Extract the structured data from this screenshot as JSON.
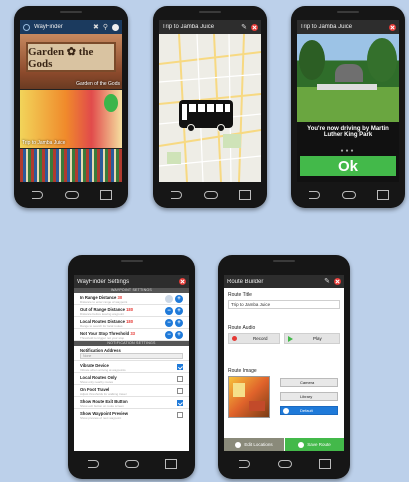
{
  "phone1": {
    "title": "WayFinder",
    "tiles": [
      {
        "image_text": "Garden ✿ the Gods",
        "caption": "Garden of the Gods"
      },
      {
        "caption": "Trip to Jamba Juice"
      },
      {
        "caption": ""
      }
    ]
  },
  "phone2": {
    "title": "Trip to Jamba Juice"
  },
  "phone3": {
    "title": "Trip to Jamba Juice",
    "driving_text": "You're now driving by Martin Luther King Park",
    "ok_label": "Ok"
  },
  "settings": {
    "title": "WayFinder Settings",
    "section1": "WAYPOINT SETTINGS",
    "rows": [
      {
        "label": "In Range Distance",
        "value": "30",
        "sub": "Distance to enter range of waypoint"
      },
      {
        "label": "Out of Range Distance",
        "value": "180",
        "sub": "Distance before leaving waypoint"
      },
      {
        "label": "Local Routes Distance",
        "value": "180",
        "sub": "Range to search for local routes"
      },
      {
        "label": "Not Your Stop Threshold",
        "value": "33",
        "sub": "Threshold to trigger not your stop"
      }
    ],
    "section2": "NOTIFICATION SETTINGS",
    "notif_label": "Notification Address",
    "notif_value": "None",
    "checks": [
      {
        "label": "Vibrate Device",
        "sub": "Vibrate when arriving at waypoints",
        "checked": true
      },
      {
        "label": "Local Routes Only",
        "sub": "Show only nearby routes",
        "checked": false
      },
      {
        "label": "On Foot Travel",
        "sub": "Adjust thresholds for walking travel",
        "checked": false
      },
      {
        "label": "Show Route Exit Button",
        "sub": "Show exit button on route screen",
        "checked": true
      },
      {
        "label": "Show Waypoint Preview",
        "sub": "Show preview of next waypoint",
        "checked": false
      }
    ]
  },
  "builder": {
    "title": "Route Builder",
    "route_title_label": "Route Title",
    "route_title_value": "Trip to Jamba Juice",
    "audio_label": "Route Audio",
    "record_label": "Record",
    "play_label": "Play",
    "image_label": "Route Image",
    "camera_label": "Camera",
    "library_label": "Library",
    "default_label": "Default",
    "edit_label": "Edit Locations",
    "save_label": "Save Route"
  },
  "colors": {
    "accent_blue": "#1f7ad9",
    "ok_green": "#43b94a",
    "close_red": "#e53935",
    "background": "#bcd0ea"
  }
}
